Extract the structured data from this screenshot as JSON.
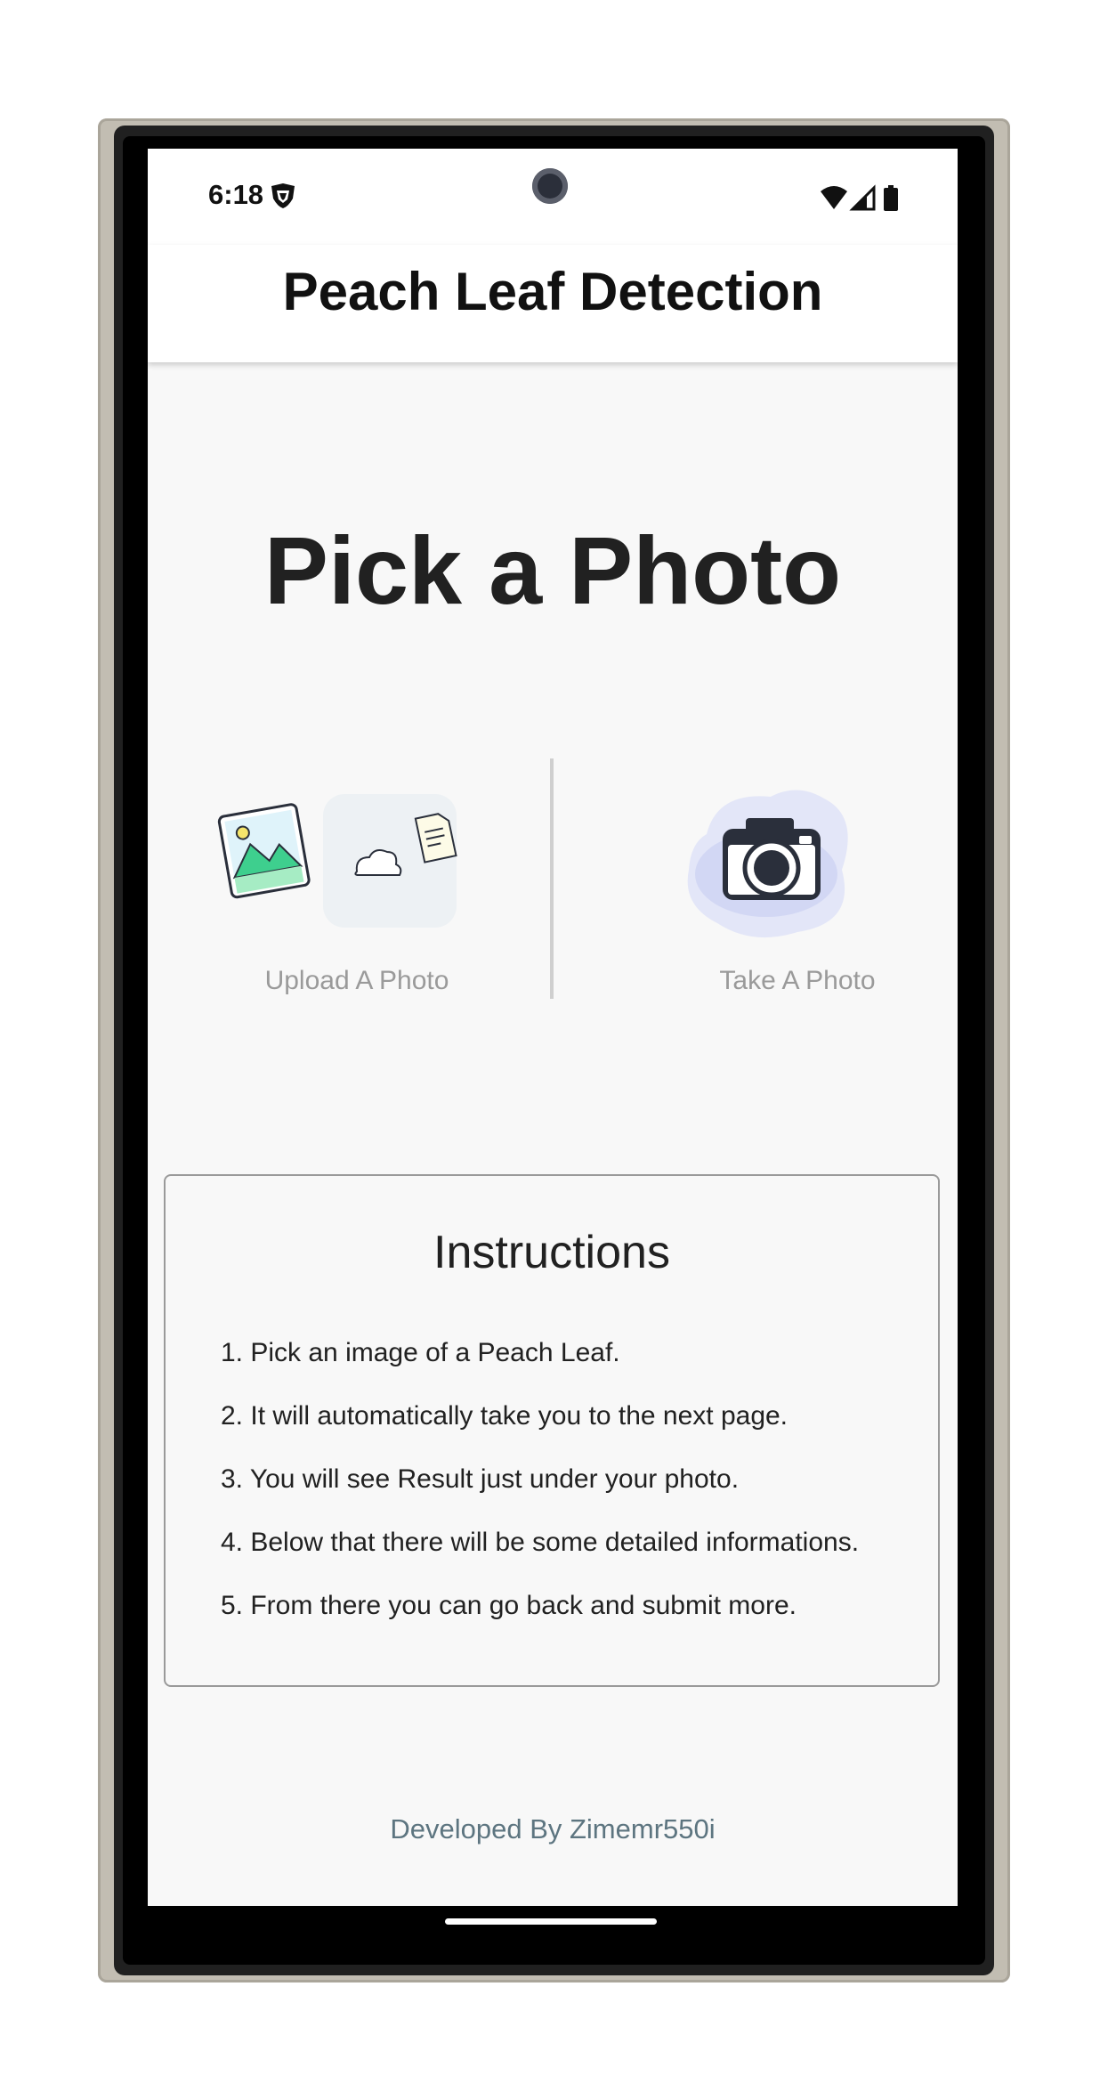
{
  "status": {
    "time": "6:18",
    "icons": [
      "shield-notification-icon",
      "wifi-icon",
      "cellular-signal-icon",
      "battery-icon"
    ]
  },
  "app_bar": {
    "title": "Peach Leaf Detection"
  },
  "main": {
    "heading": "Pick a Photo",
    "upload": {
      "label": "Upload A Photo",
      "icon": "upload-photo-illustration-icon"
    },
    "take": {
      "label": "Take A Photo",
      "icon": "camera-illustration-icon"
    }
  },
  "instructions": {
    "title": "Instructions",
    "items": [
      "1. Pick an image of a Peach Leaf.",
      "2. It will automatically take you to the next page.",
      "3. You will see Result just under your photo.",
      "4. Below that there will be some detailed informations.",
      "5. From there you can go back and submit more."
    ]
  },
  "footer": {
    "text": "Developed By Zimemr550i"
  },
  "colors": {
    "screen_bg": "#f8f8f8",
    "app_bar_bg": "#ffffff",
    "label_grey": "#9a9a9a",
    "footer_text": "#5d7580",
    "camera_blob": "#dde1f7",
    "upload_green": "#3ecf8e"
  }
}
